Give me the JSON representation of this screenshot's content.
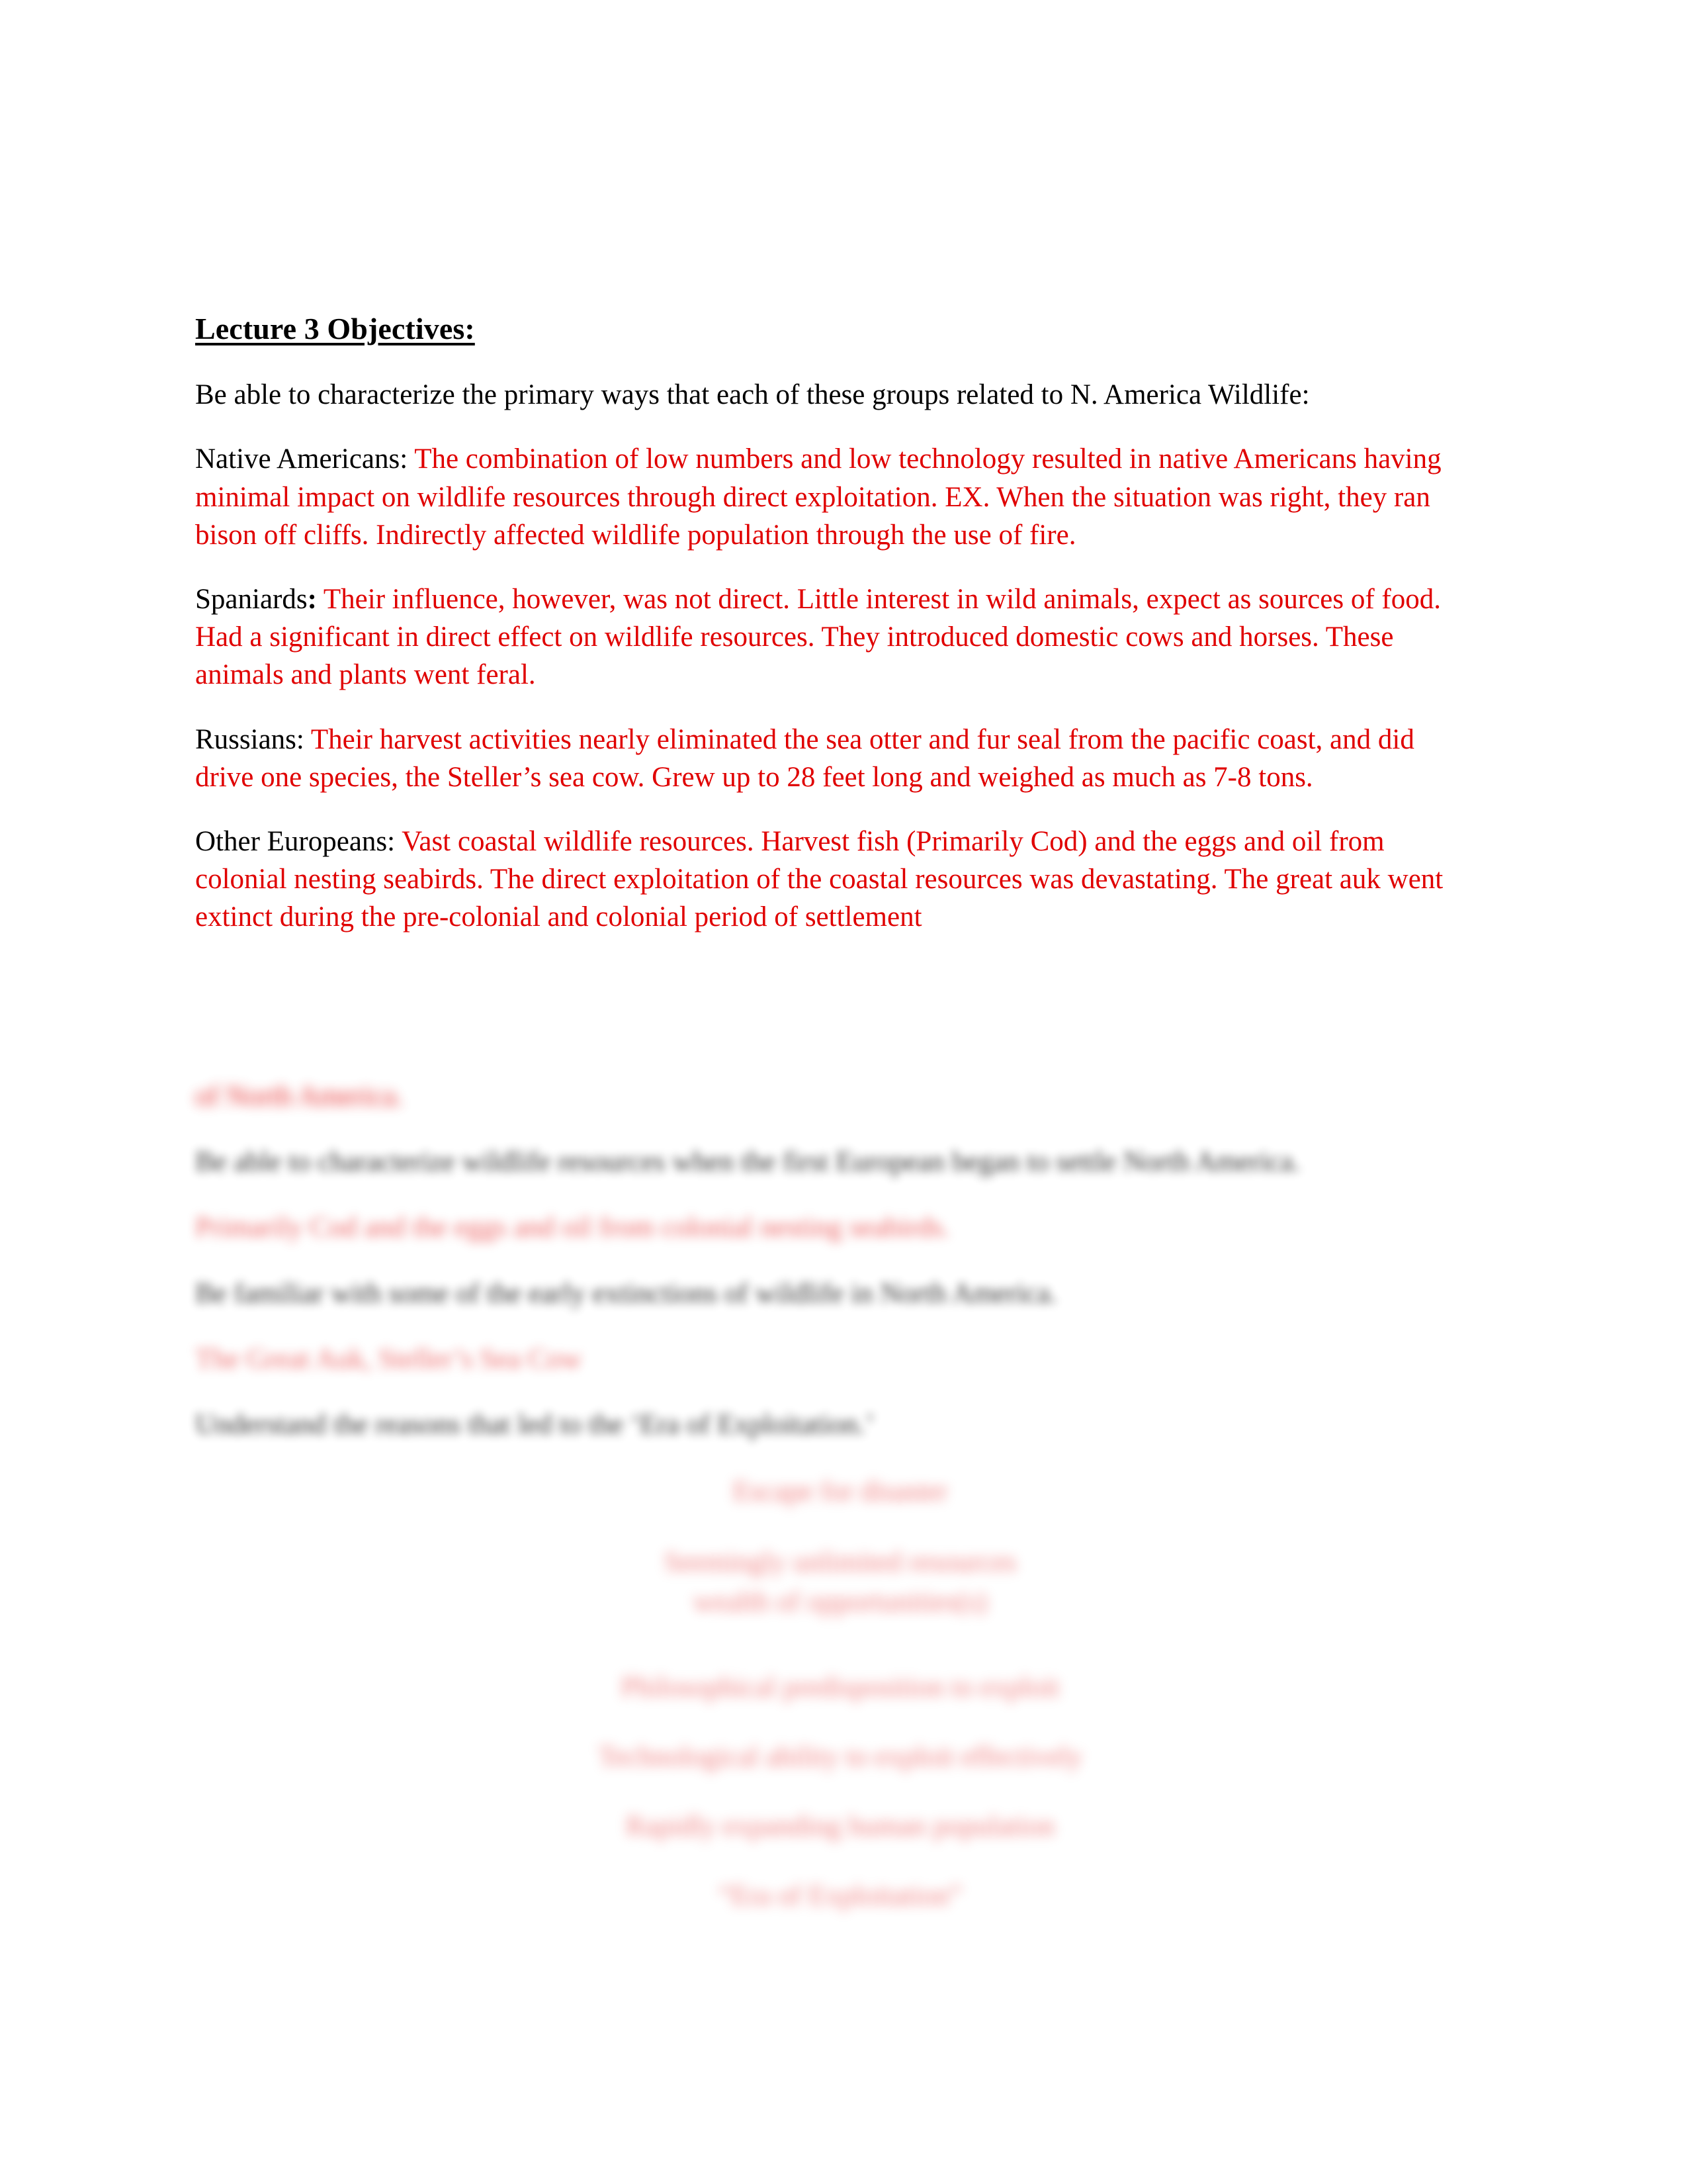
{
  "document": {
    "title": "Lecture 3 Objectives:",
    "intro": "Be able to characterize the primary ways that each of these groups related to N. America Wildlife:",
    "colors": {
      "answer_red": "#e00000",
      "prompt_black": "#000000",
      "page_background": "#ffffff"
    },
    "entries": [
      {
        "label": "Native Americans:",
        "label_colon_bold": false,
        "answer": "The combination of low numbers and low technology resulted in native Americans having minimal impact on wildlife resources through direct exploitation. EX. When the situation was right, they ran bison off cliffs. Indirectly affected wildlife population through the use of fire."
      },
      {
        "label": "Spaniards",
        "label_colon_bold": true,
        "colon": ":",
        "answer": "Their influence, however, was not direct. Little interest in wild animals, expect as sources of food. Had a significant in direct effect on wildlife resources. They introduced domestic cows and horses. These animals and plants went feral."
      },
      {
        "label": "Russians:",
        "label_colon_bold": false,
        "answer": "Their harvest activities nearly eliminated the sea otter and fur seal from the pacific coast, and did drive one species, the Steller’s sea cow. Grew up to 28 feet long and weighed as much as 7-8 tons."
      },
      {
        "label": "Other Europeans:",
        "label_colon_bold": false,
        "answer": "Vast coastal wildlife resources. Harvest fish (Primarily Cod) and the eggs and oil from colonial nesting seabirds. The direct exploitation of the coastal resources was devastating. The great auk went extinct during the pre-colonial and colonial period of settlement"
      }
    ],
    "blurred_section": {
      "note": "lower portion of page is out of focus / heavily blurred",
      "lines": [
        {
          "text": "of North America.",
          "color": "red"
        },
        {
          "text": "Be able to characterize wildlife resources when the first European began to settle North America.",
          "color": "black"
        },
        {
          "text": "Primarily Cod and the eggs and oil from colonial nesting seabirds.",
          "color": "red"
        },
        {
          "text": "Be familiar with some of the early extinctions of wildlife in North America.",
          "color": "black"
        },
        {
          "text": "The Great Auk, Steller’s Sea Cow",
          "color": "red"
        },
        {
          "text": "Understand the reasons that led to the ‘Era of Exploitation.’",
          "color": "black"
        }
      ],
      "centered_lines": [
        "Escape for disaster",
        "Seemingly unlimited resources",
        "wealth of opportunities(s)",
        "Philosophical predisposition to exploit",
        "Technological ability to exploit effectively",
        "Rapidly expanding human population",
        "“Era of Exploitation”"
      ]
    }
  }
}
